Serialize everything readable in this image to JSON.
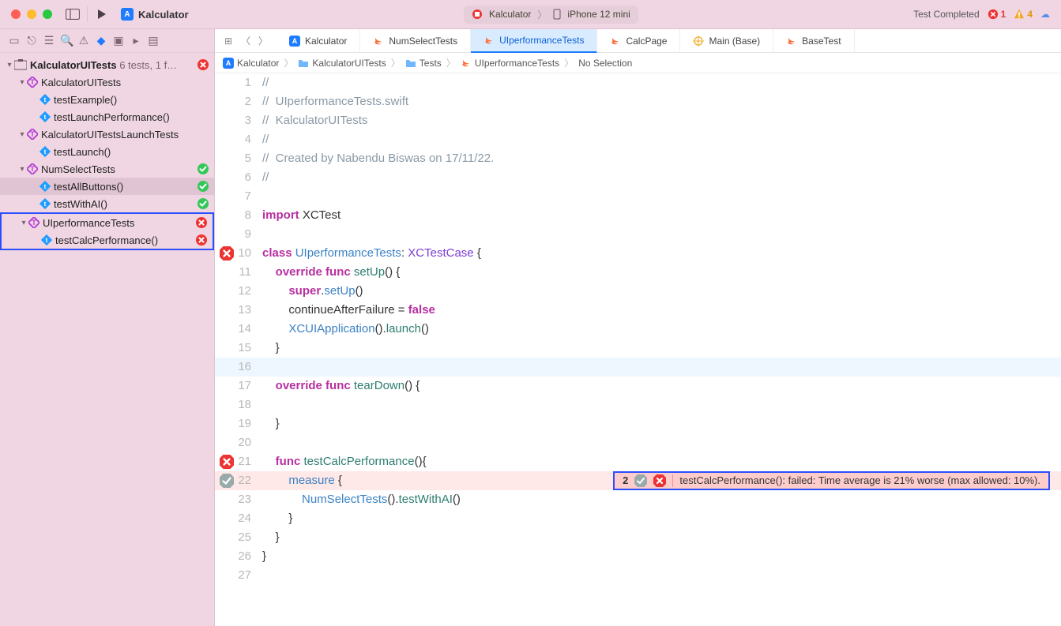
{
  "titlebar": {
    "project": "Kalculator",
    "scheme_target": "Kalculator",
    "scheme_device": "iPhone 12 mini",
    "status_text": "Test Completed",
    "errors": "1",
    "warnings": "4"
  },
  "sidebar": {
    "root_label": "KalculatorUITests",
    "root_counts": "6 tests, 1 f…",
    "items": [
      {
        "indent": 1,
        "label": "KalculatorUITests",
        "kind": "suite",
        "status": "none"
      },
      {
        "indent": 2,
        "label": "testExample()",
        "kind": "test",
        "status": "none"
      },
      {
        "indent": 2,
        "label": "testLaunchPerformance()",
        "kind": "test",
        "status": "none"
      },
      {
        "indent": 1,
        "label": "KalculatorUITestsLaunchTests",
        "kind": "suite",
        "status": "none"
      },
      {
        "indent": 2,
        "label": "testLaunch()",
        "kind": "test",
        "status": "none"
      },
      {
        "indent": 1,
        "label": "NumSelectTests",
        "kind": "suite",
        "status": "pass"
      },
      {
        "indent": 2,
        "label": "testAllButtons()",
        "kind": "test",
        "status": "pass",
        "selected": true
      },
      {
        "indent": 2,
        "label": "testWithAI()",
        "kind": "test",
        "status": "pass"
      },
      {
        "indent": 1,
        "label": "UIperformanceTests",
        "kind": "suite",
        "status": "fail",
        "annot": true
      },
      {
        "indent": 2,
        "label": "testCalcPerformance()",
        "kind": "test",
        "status": "fail",
        "annot": true
      }
    ]
  },
  "tabs": [
    {
      "label": "Kalculator",
      "icon": "app"
    },
    {
      "label": "NumSelectTests",
      "icon": "swift"
    },
    {
      "label": "UIperformanceTests",
      "icon": "swift",
      "active": true
    },
    {
      "label": "CalcPage",
      "icon": "swift"
    },
    {
      "label": "Main (Base)",
      "icon": "ib"
    },
    {
      "label": "BaseTest",
      "icon": "swift"
    }
  ],
  "breadcrumb": [
    "Kalculator",
    "KalculatorUITests",
    "Tests",
    "UIperformanceTests",
    "No Selection"
  ],
  "code": {
    "lines": [
      {
        "n": 1,
        "seg": [
          [
            "//",
            "cm"
          ]
        ]
      },
      {
        "n": 2,
        "seg": [
          [
            "//  UIperformanceTests.swift",
            "cm"
          ]
        ]
      },
      {
        "n": 3,
        "seg": [
          [
            "//  KalculatorUITests",
            "cm"
          ]
        ]
      },
      {
        "n": 4,
        "seg": [
          [
            "//",
            "cm"
          ]
        ]
      },
      {
        "n": 5,
        "seg": [
          [
            "//  Created by Nabendu Biswas on 17/11/22.",
            "cm"
          ]
        ]
      },
      {
        "n": 6,
        "seg": [
          [
            "//",
            "cm"
          ]
        ]
      },
      {
        "n": 7,
        "seg": [
          [
            "",
            ""
          ]
        ]
      },
      {
        "n": 8,
        "seg": [
          [
            "import",
            "kw"
          ],
          [
            " XCTest",
            ""
          ]
        ]
      },
      {
        "n": 9,
        "seg": [
          [
            "",
            ""
          ]
        ]
      },
      {
        "n": 10,
        "gerr": "fail",
        "seg": [
          [
            "class",
            "kw"
          ],
          [
            " ",
            ""
          ],
          [
            "UIperformanceTests",
            "id"
          ],
          [
            ": ",
            ""
          ],
          [
            "XCTestCase",
            "ty"
          ],
          [
            " {",
            ""
          ]
        ]
      },
      {
        "n": 11,
        "seg": [
          [
            "    ",
            ""
          ],
          [
            "override",
            "kw"
          ],
          [
            " ",
            ""
          ],
          [
            "func",
            "kw"
          ],
          [
            " ",
            ""
          ],
          [
            "setUp",
            "fn"
          ],
          [
            "() {",
            ""
          ]
        ]
      },
      {
        "n": 12,
        "seg": [
          [
            "        ",
            ""
          ],
          [
            "super",
            "kw"
          ],
          [
            ".",
            ""
          ],
          [
            "setUp",
            "id"
          ],
          [
            "()",
            ""
          ]
        ]
      },
      {
        "n": 13,
        "seg": [
          [
            "        continueAfterFailure = ",
            ""
          ],
          [
            "false",
            "kw"
          ]
        ]
      },
      {
        "n": 14,
        "seg": [
          [
            "        ",
            ""
          ],
          [
            "XCUIApplication",
            "id"
          ],
          [
            "().",
            ""
          ],
          [
            "launch",
            "fn"
          ],
          [
            "()",
            ""
          ]
        ]
      },
      {
        "n": 15,
        "seg": [
          [
            "    }",
            ""
          ]
        ]
      },
      {
        "n": 16,
        "cur": true,
        "seg": [
          [
            "",
            ""
          ]
        ]
      },
      {
        "n": 17,
        "seg": [
          [
            "    ",
            ""
          ],
          [
            "override",
            "kw"
          ],
          [
            " ",
            ""
          ],
          [
            "func",
            "kw"
          ],
          [
            " ",
            ""
          ],
          [
            "tearDown",
            "fn"
          ],
          [
            "() {",
            ""
          ]
        ]
      },
      {
        "n": 18,
        "seg": [
          [
            "",
            ""
          ]
        ]
      },
      {
        "n": 19,
        "seg": [
          [
            "    }",
            ""
          ]
        ]
      },
      {
        "n": 20,
        "seg": [
          [
            "",
            ""
          ]
        ]
      },
      {
        "n": 21,
        "gerr": "fail",
        "seg": [
          [
            "    ",
            ""
          ],
          [
            "func",
            "kw"
          ],
          [
            " ",
            ""
          ],
          [
            "testCalcPerformance",
            "fn"
          ],
          [
            "(){",
            ""
          ]
        ]
      },
      {
        "n": 22,
        "gerr": "gray",
        "err": true,
        "seg": [
          [
            "        ",
            ""
          ],
          [
            "measure",
            "id"
          ],
          [
            " {",
            ""
          ]
        ]
      },
      {
        "n": 23,
        "seg": [
          [
            "            ",
            ""
          ],
          [
            "NumSelectTests",
            "id"
          ],
          [
            "().",
            ""
          ],
          [
            "testWithAI",
            "fn"
          ],
          [
            "()",
            ""
          ]
        ]
      },
      {
        "n": 24,
        "seg": [
          [
            "        }",
            ""
          ]
        ]
      },
      {
        "n": 25,
        "seg": [
          [
            "    }",
            ""
          ]
        ]
      },
      {
        "n": 26,
        "seg": [
          [
            "}",
            ""
          ]
        ]
      },
      {
        "n": 27,
        "seg": [
          [
            "",
            ""
          ]
        ]
      }
    ],
    "inline_error": {
      "count": "2",
      "msg": "testCalcPerformance(): failed: Time average is 21% worse (max allowed: 10%)."
    }
  }
}
